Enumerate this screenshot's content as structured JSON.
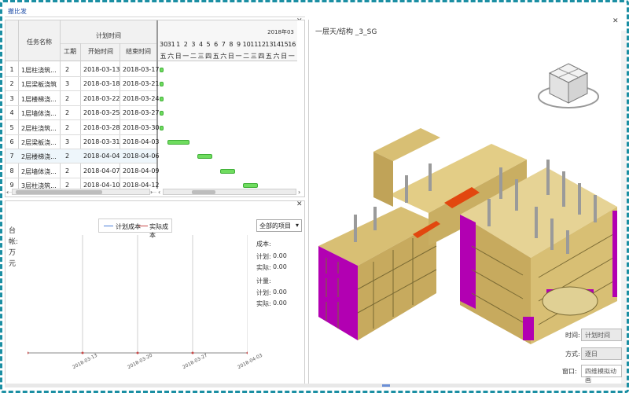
{
  "tab": {
    "label": "撤比发"
  },
  "grid": {
    "headers": {
      "task_name": "任务名称",
      "plan_time": "计划时间",
      "duration": "工期",
      "start": "开始时间",
      "end": "结束时间"
    },
    "rows": [
      {
        "num": "1",
        "name": "1层柱浇筑...",
        "duration": "2",
        "start": "2018-03-13",
        "end": "2018-03-17"
      },
      {
        "num": "2",
        "name": "1层梁板浇筑",
        "duration": "3",
        "start": "2018-03-18",
        "end": "2018-03-21"
      },
      {
        "num": "3",
        "name": "1层楼梯浇...",
        "duration": "2",
        "start": "2018-03-22",
        "end": "2018-03-24"
      },
      {
        "num": "4",
        "name": "1层墙体浇...",
        "duration": "2",
        "start": "2018-03-25",
        "end": "2018-03-27"
      },
      {
        "num": "5",
        "name": "2层柱浇筑...",
        "duration": "2",
        "start": "2018-03-28",
        "end": "2018-03-30"
      },
      {
        "num": "6",
        "name": "2层梁板浇...",
        "duration": "3",
        "start": "2018-03-31",
        "end": "2018-04-03"
      },
      {
        "num": "7",
        "name": "2层楼梯浇...",
        "duration": "2",
        "start": "2018-04-04",
        "end": "2018-04-06"
      },
      {
        "num": "8",
        "name": "2层墙体浇...",
        "duration": "2",
        "start": "2018-04-07",
        "end": "2018-04-09"
      },
      {
        "num": "9",
        "name": "3层柱浇筑...",
        "duration": "2",
        "start": "2018-04-10",
        "end": "2018-04-12"
      }
    ]
  },
  "timeline": {
    "month_label": "2018年03",
    "days": [
      "30",
      "31",
      "1",
      "2",
      "3",
      "4",
      "5",
      "6",
      "7",
      "8",
      "9",
      "10",
      "11",
      "12",
      "13",
      "14",
      "15",
      "16"
    ],
    "weekdays": [
      "五",
      "六",
      "日",
      "一",
      "二",
      "三",
      "四",
      "五",
      "六",
      "日",
      "一",
      "二",
      "三",
      "四",
      "五",
      "六",
      "日",
      "一"
    ]
  },
  "lower_chart": {
    "legend": {
      "plan": "计划成本",
      "actual": "实际成本"
    },
    "ylabel": "台帐:万元",
    "xticks": [
      "2018-03-13",
      "2018-03-20",
      "2018-03-27",
      "2018-04-03"
    ],
    "select_value": "全部的项目",
    "stats": {
      "cost_title": "成本:",
      "plan_label": "计划:",
      "plan_value": "0.00",
      "actual_label": "实际:",
      "actual_value": "0.00",
      "qty_title": "计量:",
      "qty_plan_label": "计划:",
      "qty_plan_value": "0.00",
      "qty_actual_label": "实际:",
      "qty_actual_value": "0.00"
    }
  },
  "view3d": {
    "title": "一层天/结构 _3_SG",
    "controls": {
      "time_label": "时间:",
      "time_value": "计划时间",
      "mode_label": "方式:",
      "mode_value": "逐日",
      "window_label": "窗口:",
      "window_value": "四维模拟动画"
    }
  },
  "colors": {
    "accent": "#1b8fa3",
    "bar": "#6fdc5f",
    "wall_magenta": "#b200b2",
    "slab_tan": "#d8bf74"
  }
}
